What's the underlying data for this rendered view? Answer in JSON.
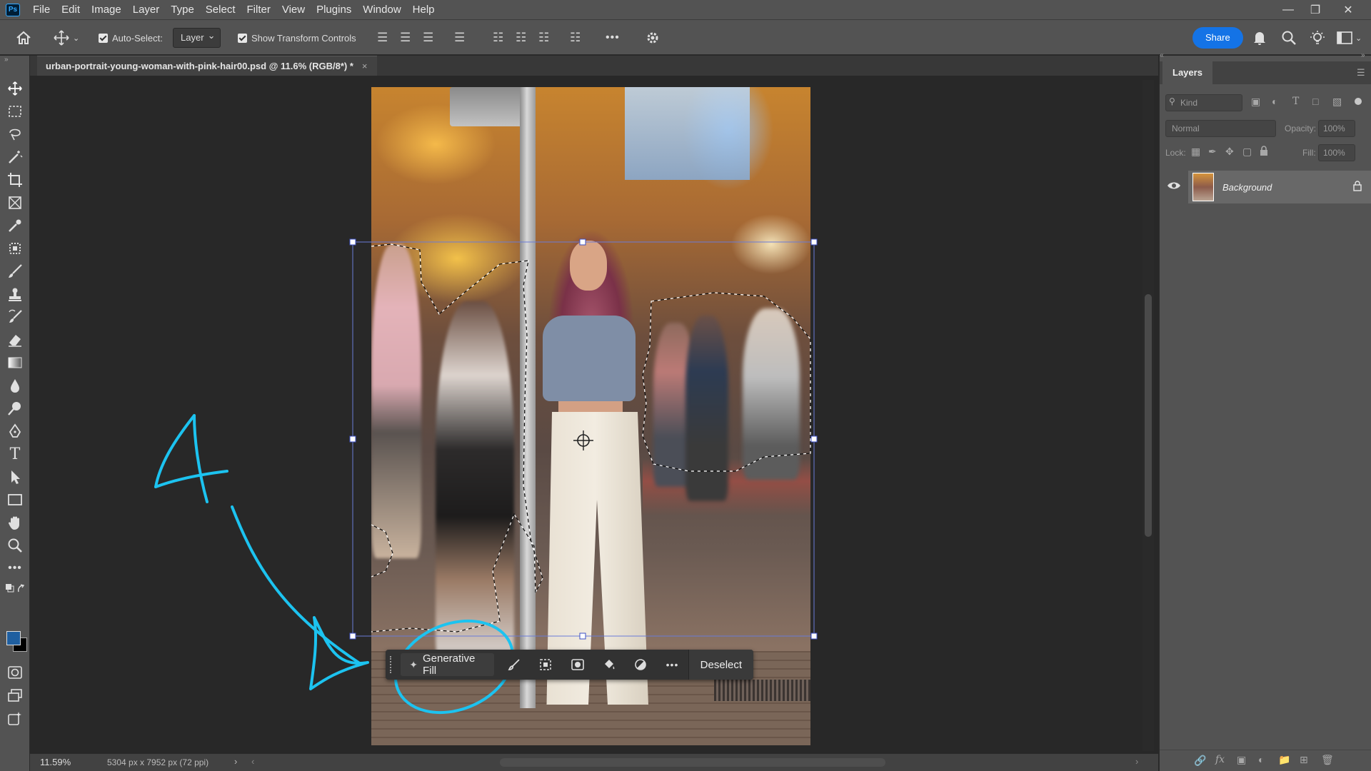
{
  "menu": {
    "logo": "Ps",
    "items": [
      "File",
      "Edit",
      "Image",
      "Layer",
      "Type",
      "Select",
      "Filter",
      "View",
      "Plugins",
      "Window",
      "Help"
    ]
  },
  "options": {
    "auto_select_label": "Auto-Select:",
    "auto_select_target": "Layer",
    "show_transform_label": "Show Transform Controls",
    "more_label": "•••",
    "share_label": "Share"
  },
  "document": {
    "tab_title": "urban-portrait-young-woman-with-pink-hair00.psd @ 11.6% (RGB/8*) *",
    "close_label": "×"
  },
  "taskbar": {
    "generative_fill_label": "Generative Fill",
    "more_label": "•••",
    "deselect_label": "Deselect"
  },
  "layers_panel": {
    "tab_label": "Layers",
    "filter_placeholder": "Kind",
    "blend_mode": "Normal",
    "opacity_label": "Opacity:",
    "opacity_value": "100%",
    "lock_label": "Lock:",
    "fill_label": "Fill:",
    "fill_value": "100%",
    "layers": [
      {
        "name": "Background",
        "visible": true,
        "locked": true
      }
    ]
  },
  "status": {
    "zoom": "11.59%",
    "doc_info": "5304 px x 7952 px (72 ppi)"
  },
  "annotation": {
    "number": "4",
    "color": "#1cc3f0"
  },
  "colors": {
    "foreground": "#1f5fa0",
    "background": "#000000",
    "accent": "#1473e6"
  }
}
